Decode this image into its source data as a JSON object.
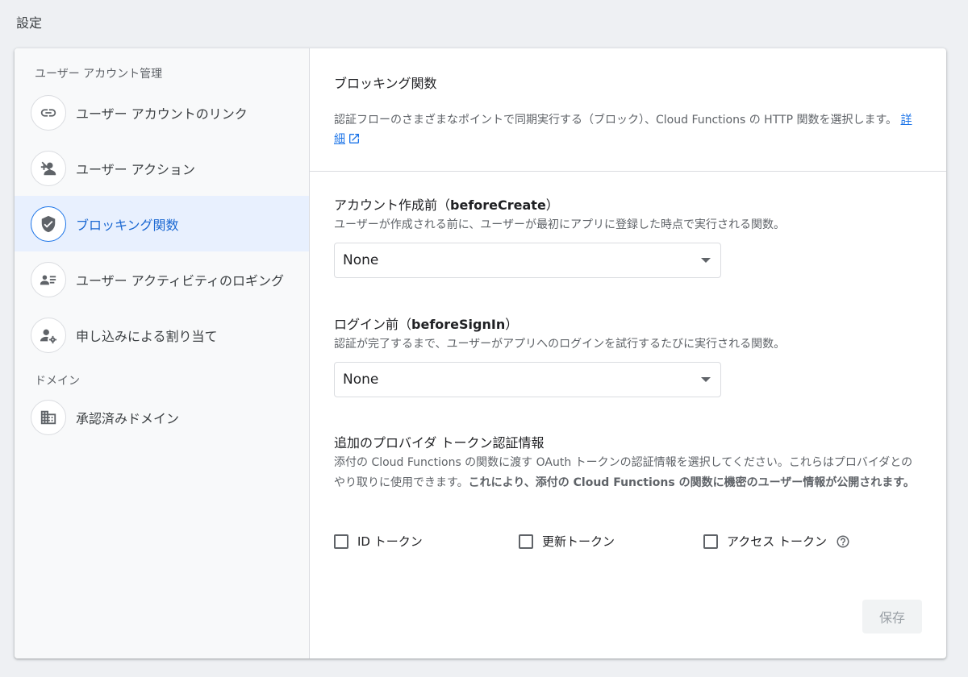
{
  "page": {
    "title": "設定"
  },
  "sidebar": {
    "section_user": "ユーザー アカウント管理",
    "items": [
      {
        "label": "ユーザー アカウントのリンク",
        "icon": "link-icon"
      },
      {
        "label": "ユーザー アクション",
        "icon": "person-off-icon"
      },
      {
        "label": "ブロッキング関数",
        "icon": "shield-check-icon",
        "active": true
      },
      {
        "label": "ユーザー アクティビティのロギング",
        "icon": "badge-list-icon"
      },
      {
        "label": "申し込みによる割り当て",
        "icon": "person-gear-icon"
      }
    ],
    "section_domain": "ドメイン",
    "domain_items": [
      {
        "label": "承認済みドメイン",
        "icon": "building-icon"
      }
    ]
  },
  "main": {
    "header": {
      "title": "ブロッキング関数",
      "desc": "認証フローのさまざまなポイントで同期実行する（ブロック）、Cloud Functions の HTTP 関数を選択します。",
      "link": "詳細"
    },
    "before_create": {
      "title_prefix": "アカウント作成前（",
      "title_code": "beforeCreate",
      "title_suffix": "）",
      "desc": "ユーザーが作成される前に、ユーザーが最初にアプリに登録した時点で実行される関数。",
      "value": "None"
    },
    "before_signin": {
      "title_prefix": "ログイン前（",
      "title_code": "beforeSignIn",
      "title_suffix": "）",
      "desc": "認証が完了するまで、ユーザーがアプリへのログインを試行するたびに実行される関数。",
      "value": "None"
    },
    "provider": {
      "title": "追加のプロバイダ トークン認証情報",
      "desc": "添付の Cloud Functions の関数に渡す OAuth トークンの認証情報を選択してください。これらはプロバイダとのやり取りに使用できます。",
      "desc_bold": "これにより、添付の Cloud Functions の関数に機密のユーザー情報が公開されます。"
    },
    "checkboxes": [
      "ID トークン",
      "更新トークン",
      "アクセス トークン"
    ],
    "save_label": "保存"
  }
}
